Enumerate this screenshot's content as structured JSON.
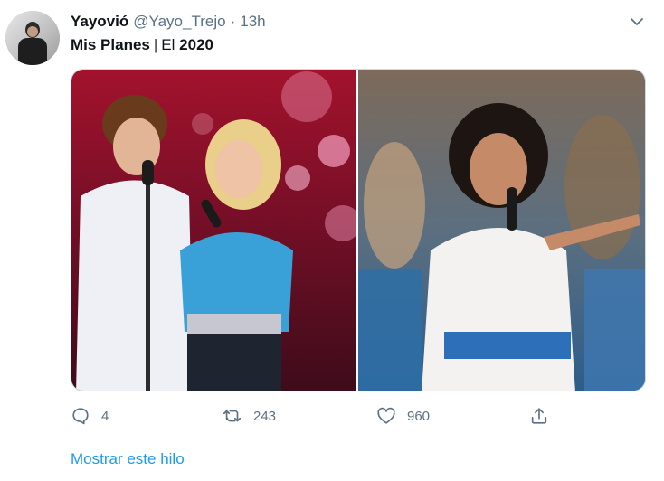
{
  "tweet": {
    "display_name": "Yayovió",
    "handle": "@Yayo_Trejo",
    "separator": "·",
    "time": "13h",
    "text_part1": "Mis Planes",
    "text_sep": "|",
    "text_part2": "El",
    "text_part3": "2020"
  },
  "actions": {
    "reply_count": "4",
    "retweet_count": "243",
    "like_count": "960"
  },
  "thread_link": "Mostrar este hilo",
  "icons": {
    "more": "chevron-down-icon",
    "reply": "reply-icon",
    "retweet": "retweet-icon",
    "like": "heart-icon",
    "share": "share-icon"
  },
  "colors": {
    "link": "#1d9bf0",
    "muted": "#5b7083",
    "text": "#0f1419"
  }
}
